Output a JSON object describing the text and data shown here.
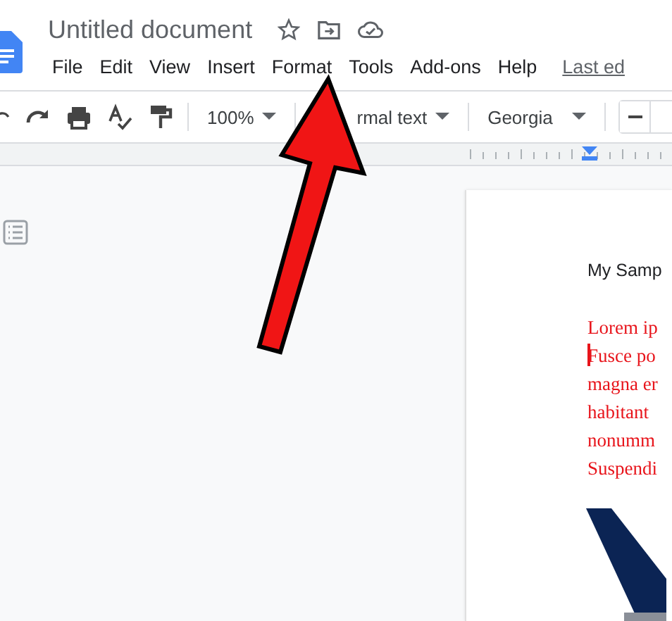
{
  "document": {
    "title": "Untitled document"
  },
  "menu": [
    "File",
    "Edit",
    "View",
    "Insert",
    "Format",
    "Tools",
    "Add-ons",
    "Help"
  ],
  "last_edit": "Last ed",
  "toolbar": {
    "zoom": "100%",
    "style": "rmal text",
    "font": "Georgia"
  },
  "page": {
    "heading": "My Samp",
    "body_lines": [
      "Lorem ip",
      "Fusce po",
      "magna er",
      "habitant",
      "nonumm",
      "Suspendi"
    ]
  }
}
